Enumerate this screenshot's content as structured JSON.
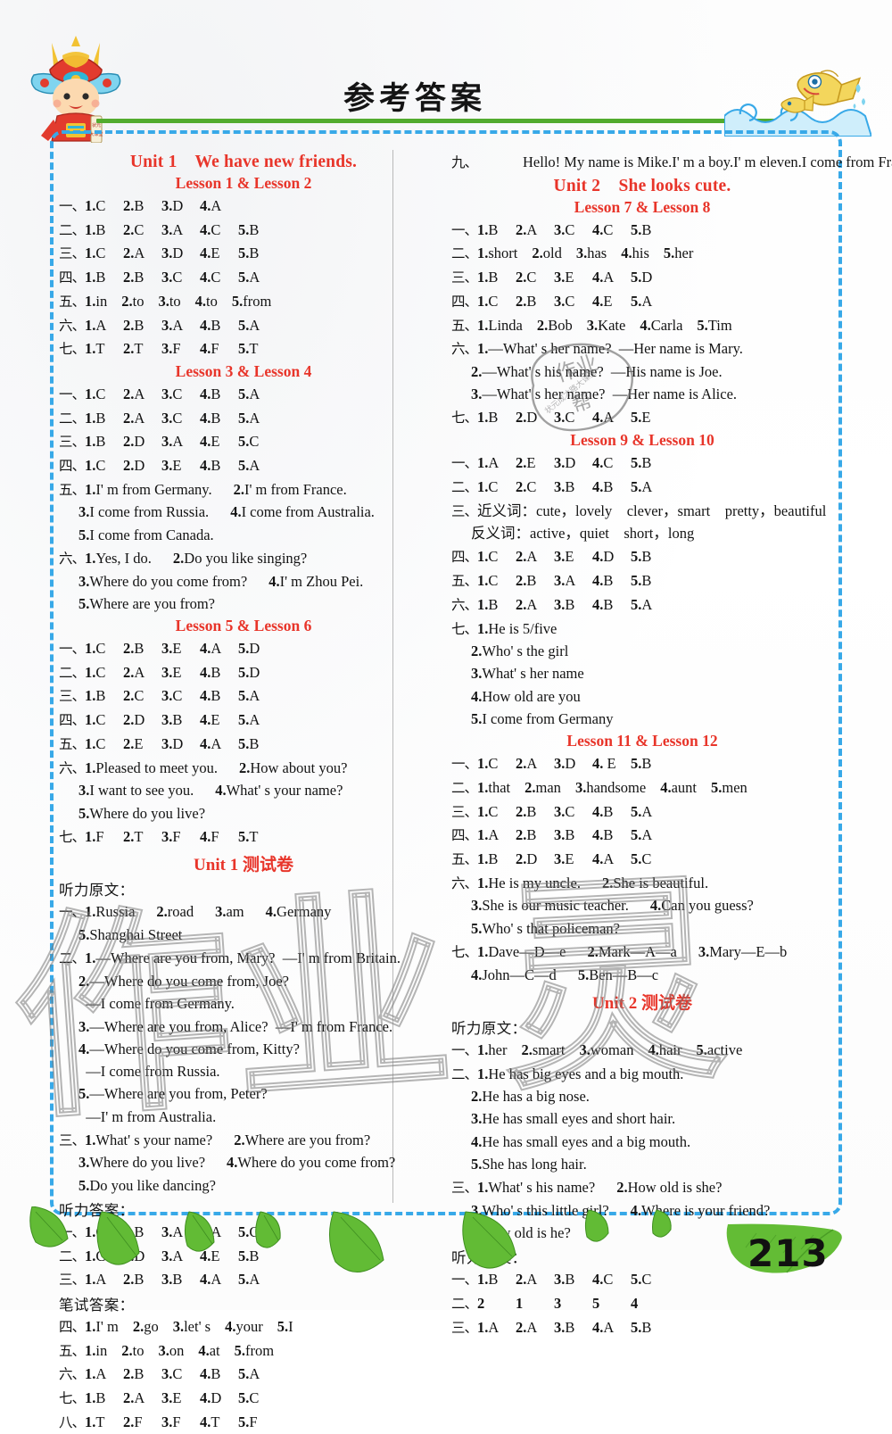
{
  "header": {
    "title": "参考答案",
    "mascot_icon": "boy-mascot-icon",
    "fish_icon": "fish-wave-icon"
  },
  "page_number": "213",
  "colors": {
    "heading_red": "#e8352a",
    "green_rule": "#52ab2e",
    "dashed_border": "#38a9e8",
    "body_text": "#131313"
  },
  "watermarks": {
    "left_text": "作业",
    "right_text": "灵",
    "stamp_text": "作业"
  },
  "left_column": [
    {
      "type": "unit",
      "text": "Unit 1    We have new friends."
    },
    {
      "type": "lesson",
      "text": "Lesson 1 & Lesson 2"
    },
    {
      "type": "answers",
      "marker": "一、",
      "items": [
        "1.C",
        "2.B",
        "3.D",
        "4.A"
      ]
    },
    {
      "type": "answers",
      "marker": "二、",
      "items": [
        "1.B",
        "2.C",
        "3.A",
        "4.C",
        "5.B"
      ]
    },
    {
      "type": "answers",
      "marker": "三、",
      "items": [
        "1.C",
        "2.A",
        "3.D",
        "4.E",
        "5.B"
      ]
    },
    {
      "type": "answers",
      "marker": "四、",
      "items": [
        "1.B",
        "2.B",
        "3.C",
        "4.C",
        "5.A"
      ]
    },
    {
      "type": "answers",
      "marker": "五、",
      "items": [
        "1.in",
        "2.to",
        "3.to",
        "4.to",
        "5.from"
      ]
    },
    {
      "type": "answers",
      "marker": "六、",
      "items": [
        "1.A",
        "2.B",
        "3.A",
        "4.B",
        "5.A"
      ]
    },
    {
      "type": "answers",
      "marker": "七、",
      "items": [
        "1.T",
        "2.T",
        "3.F",
        "4.F",
        "5.T"
      ]
    },
    {
      "type": "lesson",
      "text": "Lesson 3 & Lesson 4"
    },
    {
      "type": "answers",
      "marker": "一、",
      "items": [
        "1.C",
        "2.A",
        "3.C",
        "4.B",
        "5.A"
      ]
    },
    {
      "type": "answers",
      "marker": "二、",
      "items": [
        "1.B",
        "2.A",
        "3.C",
        "4.B",
        "5.A"
      ]
    },
    {
      "type": "answers",
      "marker": "三、",
      "items": [
        "1.B",
        "2.D",
        "3.A",
        "4.E",
        "5.C"
      ]
    },
    {
      "type": "answers",
      "marker": "四、",
      "items": [
        "1.C",
        "2.D",
        "3.E",
        "4.B",
        "5.A"
      ]
    },
    {
      "type": "sentences",
      "marker": "五、",
      "lines": [
        [
          "1.I' m from Germany.",
          "2.I' m from France."
        ],
        [
          "3.I come from Russia.",
          "4.I come from Australia."
        ],
        [
          "5.I come from Canada."
        ]
      ]
    },
    {
      "type": "sentences",
      "marker": "六、",
      "lines": [
        [
          "1.Yes, I do.",
          "2.Do you like singing?"
        ],
        [
          "3.Where do you come from?",
          "4.I' m Zhou Pei."
        ],
        [
          "5.Where are you from?"
        ]
      ]
    },
    {
      "type": "lesson",
      "text": "Lesson 5 & Lesson 6"
    },
    {
      "type": "answers",
      "marker": "一、",
      "items": [
        "1.C",
        "2.B",
        "3.E",
        "4.A",
        "5.D"
      ]
    },
    {
      "type": "answers",
      "marker": "二、",
      "items": [
        "1.C",
        "2.A",
        "3.E",
        "4.B",
        "5.D"
      ]
    },
    {
      "type": "answers",
      "marker": "三、",
      "items": [
        "1.B",
        "2.C",
        "3.C",
        "4.B",
        "5.A"
      ]
    },
    {
      "type": "answers",
      "marker": "四、",
      "items": [
        "1.C",
        "2.D",
        "3.B",
        "4.E",
        "5.A"
      ]
    },
    {
      "type": "answers",
      "marker": "五、",
      "items": [
        "1.C",
        "2.E",
        "3.D",
        "4.A",
        "5.B"
      ]
    },
    {
      "type": "sentences",
      "marker": "六、",
      "lines": [
        [
          "1.Pleased to meet you.",
          "2.How about you?"
        ],
        [
          "3.I want to see you.",
          "4.What' s your name?"
        ],
        [
          "5.Where do you live?"
        ]
      ]
    },
    {
      "type": "answers",
      "marker": "七、",
      "items": [
        "1.F",
        "2.T",
        "3.F",
        "4.F",
        "5.T"
      ]
    },
    {
      "type": "test",
      "text": "Unit 1 测试卷"
    },
    {
      "type": "cn",
      "text": "听力原文："
    },
    {
      "type": "sentences",
      "marker": "一、",
      "lines": [
        [
          "1.Russia",
          "2.road",
          "3.am",
          "4.Germany"
        ],
        [
          "5.Shanghai Street"
        ]
      ]
    },
    {
      "type": "sentences",
      "marker": "二、",
      "lines": [
        [
          "1.—Where are you from, Mary?  —I' m from Britain."
        ],
        [
          "2.—Where do you come from, Joe?"
        ],
        [
          "  —I come from Germany."
        ],
        [
          "3.—Where are you from, Alice?  —I' m from France."
        ],
        [
          "4.—Where do you come from, Kitty?"
        ],
        [
          "  —I come from Russia."
        ],
        [
          "5.—Where are you from, Peter?"
        ],
        [
          "  —I' m from Australia."
        ]
      ]
    },
    {
      "type": "sentences",
      "marker": "三、",
      "lines": [
        [
          "1.What' s your name?",
          "2.Where are you from?"
        ],
        [
          "3.Where do you live?",
          "4.Where do you come from?"
        ],
        [
          "5.Do you like dancing?"
        ]
      ]
    },
    {
      "type": "cn",
      "text": "听力答案："
    },
    {
      "type": "answers",
      "marker": "一、",
      "items": [
        "1.C",
        "2.B",
        "3.A",
        "4.A",
        "5.C"
      ]
    },
    {
      "type": "answers",
      "marker": "二、",
      "items": [
        "1.C",
        "2.D",
        "3.A",
        "4.E",
        "5.B"
      ]
    },
    {
      "type": "answers",
      "marker": "三、",
      "items": [
        "1.A",
        "2.B",
        "3.B",
        "4.A",
        "5.A"
      ]
    },
    {
      "type": "cn",
      "text": "笔试答案："
    },
    {
      "type": "answers",
      "marker": "四、",
      "items": [
        "1.I' m",
        "2.go",
        "3.let' s",
        "4.your",
        "5.I"
      ]
    },
    {
      "type": "answers",
      "marker": "五、",
      "items": [
        "1.in",
        "2.to",
        "3.on",
        "4.at",
        "5.from"
      ]
    },
    {
      "type": "answers",
      "marker": "六、",
      "items": [
        "1.A",
        "2.B",
        "3.C",
        "4.B",
        "5.A"
      ]
    },
    {
      "type": "answers",
      "marker": "七、",
      "items": [
        "1.B",
        "2.A",
        "3.E",
        "4.D",
        "5.C"
      ]
    },
    {
      "type": "answers",
      "marker": "八、",
      "items": [
        "1.T",
        "2.F",
        "3.F",
        "4.T",
        "5.F"
      ]
    }
  ],
  "right_column": [
    {
      "type": "para",
      "marker": "九、",
      "indent": true,
      "text": "Hello! My name is Mike.I' m a boy.I' m eleven.I come from France.I live in Sunny City.I live at 20 Apple Street.I like singing.Do you like me?"
    },
    {
      "type": "unit",
      "text": "Unit 2    She looks cute."
    },
    {
      "type": "lesson",
      "text": "Lesson 7 & Lesson 8"
    },
    {
      "type": "answers",
      "marker": "一、",
      "items": [
        "1.B",
        "2.A",
        "3.C",
        "4.C",
        "5.B"
      ]
    },
    {
      "type": "answers",
      "marker": "二、",
      "items": [
        "1.short",
        "2.old",
        "3.has",
        "4.his",
        "5.her"
      ]
    },
    {
      "type": "answers",
      "marker": "三、",
      "items": [
        "1.B",
        "2.C",
        "3.E",
        "4.A",
        "5.D"
      ]
    },
    {
      "type": "answers",
      "marker": "四、",
      "items": [
        "1.C",
        "2.B",
        "3.C",
        "4.E",
        "5.A"
      ]
    },
    {
      "type": "answers",
      "marker": "五、",
      "items": [
        "1.Linda",
        "2.Bob",
        "3.Kate",
        "4.Carla",
        "5.Tim"
      ]
    },
    {
      "type": "sentences",
      "marker": "六、",
      "lines": [
        [
          "1.—What' s her name?  —Her name is Mary."
        ],
        [
          "2.—What' s his name?  —His name is Joe."
        ],
        [
          "3.—What' s her name?  —Her name is Alice."
        ]
      ]
    },
    {
      "type": "answers",
      "marker": "七、",
      "items": [
        "1.B",
        "2.D",
        "3.C",
        "4.A",
        "5.E"
      ]
    },
    {
      "type": "lesson",
      "text": "Lesson 9 & Lesson 10"
    },
    {
      "type": "answers",
      "marker": "一、",
      "items": [
        "1.A",
        "2.E",
        "3.D",
        "4.C",
        "5.B"
      ]
    },
    {
      "type": "answers",
      "marker": "二、",
      "items": [
        "1.C",
        "2.C",
        "3.B",
        "4.B",
        "5.A"
      ]
    },
    {
      "type": "sentences",
      "marker": "三、",
      "lines": [
        [
          "近义词：cute，lovely　clever，smart　pretty，beautiful"
        ],
        [
          "反义词：active，quiet　short，long"
        ]
      ]
    },
    {
      "type": "answers",
      "marker": "四、",
      "items": [
        "1.C",
        "2.A",
        "3.E",
        "4.D",
        "5.B"
      ]
    },
    {
      "type": "answers",
      "marker": "五、",
      "items": [
        "1.C",
        "2.B",
        "3.A",
        "4.B",
        "5.B"
      ]
    },
    {
      "type": "answers",
      "marker": "六、",
      "items": [
        "1.B",
        "2.A",
        "3.B",
        "4.B",
        "5.A"
      ]
    },
    {
      "type": "sentences",
      "marker": "七、",
      "lines": [
        [
          "1.He is 5/five"
        ],
        [
          "2.Who' s the girl"
        ],
        [
          "3.What' s her name"
        ],
        [
          "4.How old are you"
        ],
        [
          "5.I come from Germany"
        ]
      ]
    },
    {
      "type": "lesson",
      "text": "Lesson 11 & Lesson 12"
    },
    {
      "type": "answers",
      "marker": "一、",
      "items": [
        "1.C",
        "2.A",
        "3.D",
        "4. E",
        "5.B"
      ]
    },
    {
      "type": "answers",
      "marker": "二、",
      "items": [
        "1.that",
        "2.man",
        "3.handsome",
        "4.aunt",
        "5.men"
      ]
    },
    {
      "type": "answers",
      "marker": "三、",
      "items": [
        "1.C",
        "2.B",
        "3.C",
        "4.B",
        "5.A"
      ]
    },
    {
      "type": "answers",
      "marker": "四、",
      "items": [
        "1.A",
        "2.B",
        "3.B",
        "4.B",
        "5.A"
      ]
    },
    {
      "type": "answers",
      "marker": "五、",
      "items": [
        "1.B",
        "2.D",
        "3.E",
        "4.A",
        "5.C"
      ]
    },
    {
      "type": "sentences",
      "marker": "六、",
      "lines": [
        [
          "1.He is my uncle.",
          "2.She is beautiful."
        ],
        [
          "3.She is our music teacher.",
          "4.Can you guess?"
        ],
        [
          "5.Who' s that policeman?"
        ]
      ]
    },
    {
      "type": "sentences",
      "marker": "七、",
      "lines": [
        [
          "1.Dave—D—e",
          "2.Mark—A—a",
          "3.Mary—E—b"
        ],
        [
          "4.John—C—d",
          "5.Ben—B—c"
        ]
      ]
    },
    {
      "type": "test",
      "text": "Unit 2 测试卷"
    },
    {
      "type": "cn",
      "text": "听力原文："
    },
    {
      "type": "answers",
      "marker": "一、",
      "items": [
        "1.her",
        "2.smart",
        "3.woman",
        "4.hair",
        "5.active"
      ]
    },
    {
      "type": "sentences",
      "marker": "二、",
      "lines": [
        [
          "1.He has big eyes and a big mouth."
        ],
        [
          "2.He has a big nose."
        ],
        [
          "3.He has small eyes and short hair."
        ],
        [
          "4.He has small eyes and a big mouth."
        ],
        [
          "5.She has long hair."
        ]
      ]
    },
    {
      "type": "sentences",
      "marker": "三、",
      "lines": [
        [
          "1.What' s his name?",
          "2.How old is she?"
        ],
        [
          "3.Who' s this little girl?",
          "4.Where is your friend?"
        ],
        [
          "5.How old is he?"
        ]
      ]
    },
    {
      "type": "cn",
      "text": "听力答案："
    },
    {
      "type": "answers",
      "marker": "一、",
      "items": [
        "1.B",
        "2.A",
        "3.B",
        "4.C",
        "5.C"
      ]
    },
    {
      "type": "answers",
      "marker": "二、",
      "items": [
        "2",
        "1",
        "3",
        "5",
        "4"
      ]
    },
    {
      "type": "answers",
      "marker": "三、",
      "items": [
        "1.A",
        "2.A",
        "3.B",
        "4.A",
        "5.B"
      ]
    }
  ]
}
